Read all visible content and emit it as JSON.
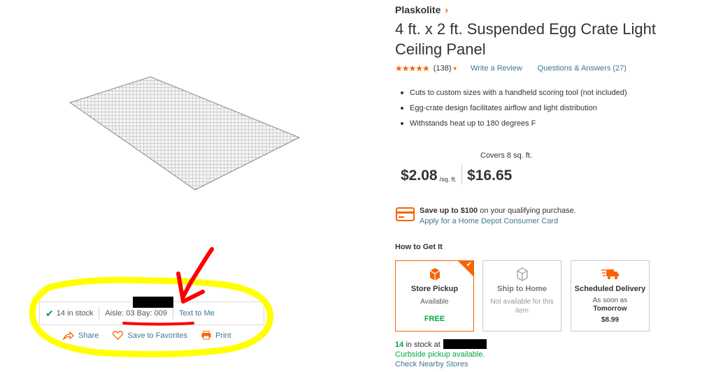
{
  "product": {
    "brand": "Plaskolite",
    "title": "4 ft. x 2 ft. Suspended Egg Crate Light Ceiling Panel",
    "rating_stars": "★★★★★",
    "rating_value": 4.5,
    "review_count": "(138)",
    "write_review": "Write a Review",
    "qa_link": "Questions & Answers (27)",
    "bullets": [
      "Cuts to custom sizes with a handheld scoring tool (not included)",
      "Egg-crate design facilitates airflow and light distribution",
      "Withstands heat up to 180 degrees F"
    ]
  },
  "pricing": {
    "covers": "Covers 8 sq. ft.",
    "price_per_unit": "$2.08",
    "unit": "/sq. ft.",
    "price_total": "$16.65"
  },
  "credit_card": {
    "save_prefix": "Save up to",
    "save_amount": "$100",
    "save_suffix": "on your qualifying purchase.",
    "apply_link": "Apply for a Home Depot Consumer Card"
  },
  "fulfillment": {
    "title": "How to Get It",
    "options": [
      {
        "name": "Store Pickup",
        "status": "Available",
        "price": "FREE",
        "selected": true
      },
      {
        "name": "Ship to Home",
        "status": "Not available for this item"
      },
      {
        "name": "Scheduled Delivery",
        "status": "As soon as",
        "when": "Tomorrow",
        "price": "$8.99"
      }
    ],
    "stock_count": "14",
    "stock_text": "in stock at",
    "curbside": "Curbside pickup available.",
    "nearby": "Check Nearby Stores"
  },
  "store_stock": {
    "in_stock": "14 in stock",
    "location": "Aisle: 03 Bay: 009",
    "text_to_me": "Text to Me"
  },
  "share_row": {
    "share": "Share",
    "favorites": "Save to Favorites",
    "print": "Print"
  },
  "colors": {
    "accent": "#f96302",
    "link": "#3e7697",
    "green": "#00a83e",
    "highlight": "#ffff00",
    "annotation_red": "#ff0000"
  }
}
